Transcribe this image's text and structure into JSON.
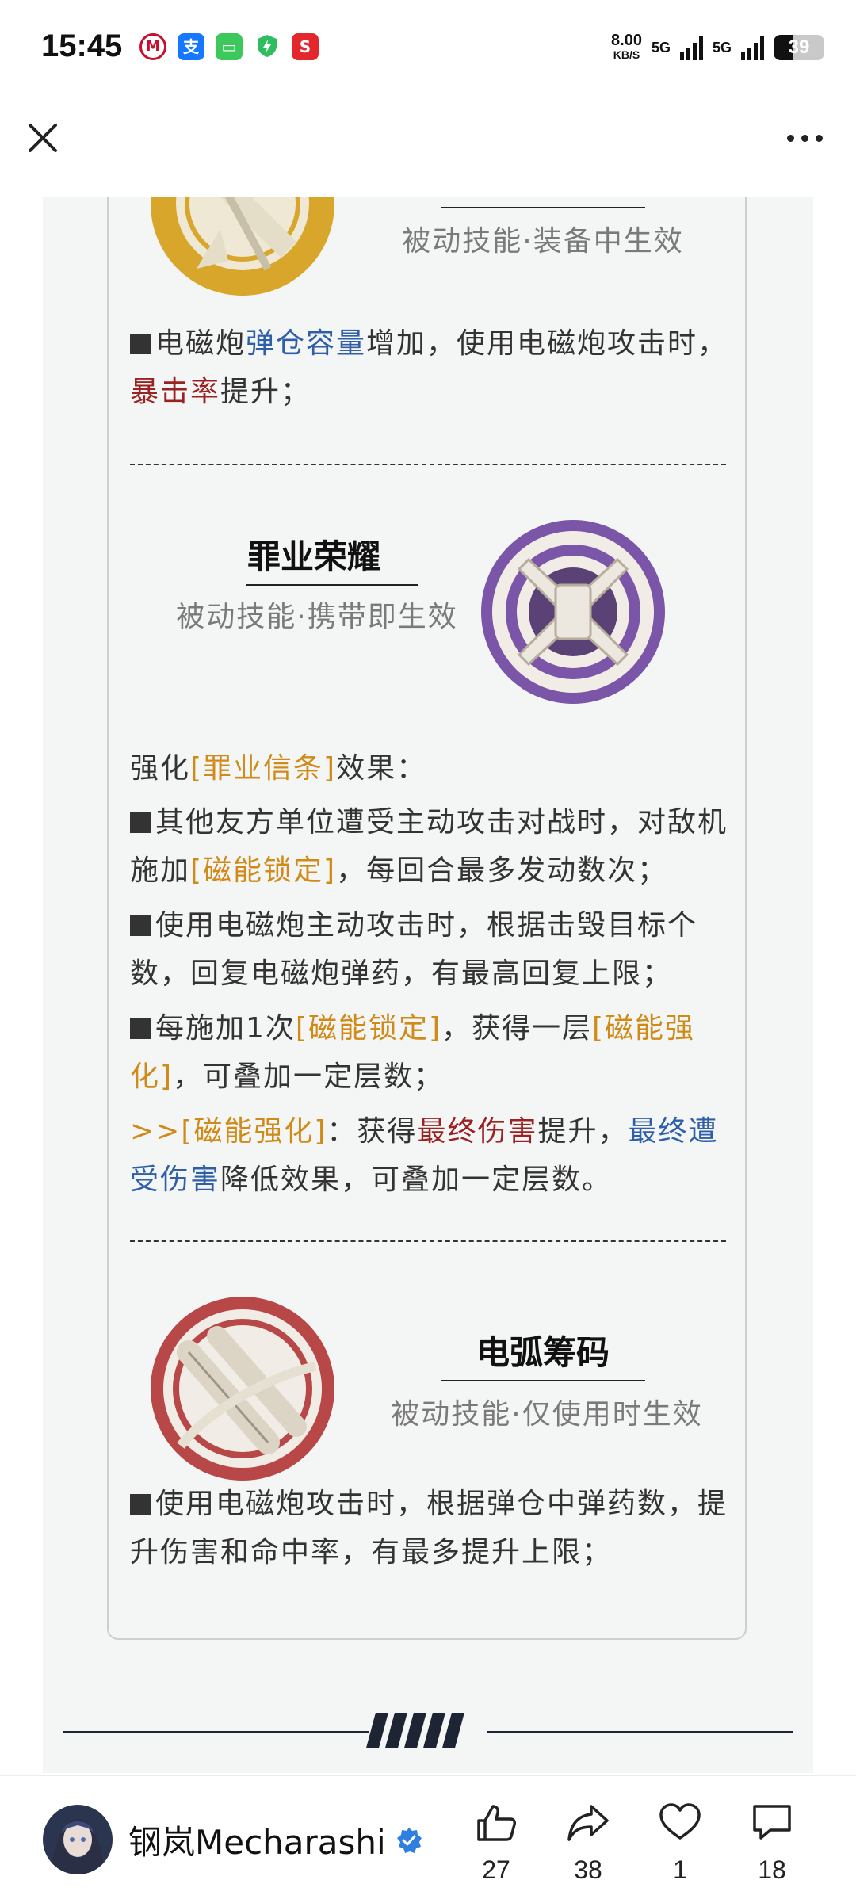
{
  "status_bar": {
    "time": "15:45",
    "net_speed_value": "8.00",
    "net_speed_unit": "KB/S",
    "signal1": "5G",
    "signal2": "5G",
    "battery": "39",
    "notification_icons": [
      "metro-icon",
      "alipay-icon",
      "messages-icon",
      "security-icon",
      "app-s-icon"
    ]
  },
  "nav": {
    "close_icon": "close-icon",
    "more_icon": "more-icon"
  },
  "skills": [
    {
      "type": "被动技能·装备中生效",
      "description": {
        "p1": "电磁炮",
        "h1": "弹仓容量",
        "p2": "增加，使用电磁炮攻击时，",
        "h2": "暴击率",
        "p3": "提升；"
      }
    },
    {
      "name": "罪业荣耀",
      "type": "被动技能·携带即生效",
      "intro": {
        "p1": "强化",
        "h1": "[罪业信条]",
        "p2": "效果："
      },
      "effects": [
        {
          "p1": "其他友方单位遭受主动攻击对战时，对敌机施加",
          "h1": "[磁能锁定]",
          "p2": "，每回合最多发动数次；"
        },
        {
          "p1": "使用电磁炮主动攻击时，根据击毁目标个数，回复电磁炮弹药，有最高回复上限；"
        },
        {
          "p1": "每施加1次",
          "h1": "[磁能锁定]",
          "p2": "，获得一层",
          "h2": "[磁能强化]",
          "p3": "，可叠加一定层数；"
        }
      ],
      "note": {
        "h1": ">>[磁能强化]",
        "p1": "：获得",
        "h2": "最终伤害",
        "p2": "提升，",
        "h3": "最终遭受伤害",
        "p3": "降低效果，可叠加一定层数。"
      }
    },
    {
      "name": "电弧筹码",
      "type": "被动技能·仅使用时生效",
      "description": "使用电磁炮攻击时，根据弹仓中弹药数，提升伤害和命中率，有最多提升上限；"
    }
  ],
  "author": {
    "name": "钢岚Mecharashi",
    "verified": true
  },
  "actions": {
    "like": {
      "icon": "thumbs-up-icon",
      "count": "27"
    },
    "share": {
      "icon": "share-icon",
      "count": "38"
    },
    "favorite": {
      "icon": "heart-icon",
      "count": "1"
    },
    "comment": {
      "icon": "comment-icon",
      "count": "18"
    }
  },
  "colors": {
    "link_blue": "#2e5fa8",
    "highlight_red": "#9a2222",
    "keyword_gold": "#cf8a18",
    "emblem_gold": "#d9a62c",
    "emblem_purple": "#7b55a8",
    "emblem_red": "#b84848",
    "verify_blue": "#2f7fe0"
  }
}
